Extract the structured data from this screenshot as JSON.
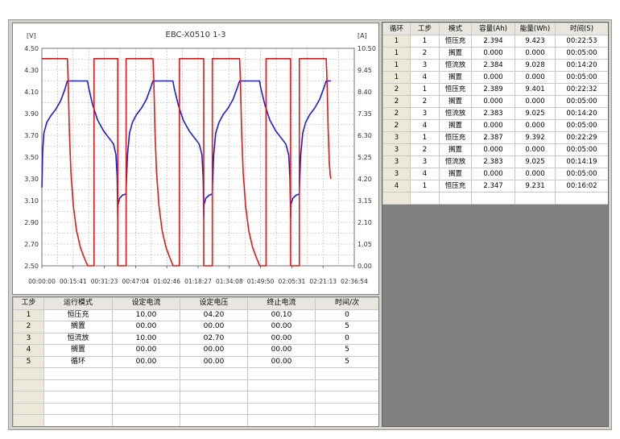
{
  "chart": {
    "title": "EBC-X0510 1-3",
    "left_unit": "[V]",
    "right_unit": "[A]",
    "left_ticks": [
      "4.50",
      "4.30",
      "4.10",
      "3.90",
      "3.70",
      "3.50",
      "3.30",
      "3.10",
      "2.90",
      "2.70",
      "2.50"
    ],
    "right_ticks": [
      "10.50",
      "9.45",
      "8.40",
      "7.35",
      "6.30",
      "5.25",
      "4.20",
      "3.15",
      "2.10",
      "1.05",
      "0.00"
    ],
    "x_ticks": [
      "00:00:00",
      "00:15:41",
      "00:31:23",
      "00:47:04",
      "01:02:46",
      "01:18:27",
      "01:34:08",
      "01:49:50",
      "02:05:31",
      "02:21:13",
      "02:36:54"
    ]
  },
  "chart_data": {
    "type": "line",
    "title": "EBC-X0510 1-3",
    "xlabel": "",
    "ylabel": "[V]",
    "y2label": "[A]",
    "x_unit": "minutes",
    "xlim": [
      0,
      156.9
    ],
    "ylim": [
      2.5,
      4.5
    ],
    "y2lim": [
      0,
      10.5
    ],
    "grid": true,
    "series": [
      {
        "name": "",
        "axis": "left",
        "color": "#1c1cd8",
        "points": [
          [
            0,
            3.22
          ],
          [
            0.4,
            3.55
          ],
          [
            1,
            3.72
          ],
          [
            2.5,
            3.82
          ],
          [
            4.5,
            3.88
          ],
          [
            7,
            3.94
          ],
          [
            9.5,
            4.02
          ],
          [
            11.5,
            4.12
          ],
          [
            12.8,
            4.2
          ],
          [
            22.9,
            4.2
          ],
          [
            23.6,
            4.13
          ],
          [
            25.5,
            3.98
          ],
          [
            28,
            3.84
          ],
          [
            31,
            3.74
          ],
          [
            33.5,
            3.68
          ],
          [
            36,
            3.62
          ],
          [
            37.2,
            3.52
          ],
          [
            37.8,
            3.32
          ],
          [
            38.1,
            2.95
          ],
          [
            38.2,
            3.06
          ],
          [
            39,
            3.12
          ],
          [
            40.5,
            3.15
          ],
          [
            42.3,
            3.16
          ],
          [
            42.4,
            3.25
          ],
          [
            43,
            3.52
          ],
          [
            44,
            3.72
          ],
          [
            45.5,
            3.82
          ],
          [
            47.5,
            3.89
          ],
          [
            50,
            3.95
          ],
          [
            52.5,
            4.03
          ],
          [
            54.5,
            4.13
          ],
          [
            55.8,
            4.2
          ],
          [
            65.8,
            4.2
          ],
          [
            66.5,
            4.13
          ],
          [
            68.5,
            3.98
          ],
          [
            71,
            3.84
          ],
          [
            74,
            3.74
          ],
          [
            76.5,
            3.68
          ],
          [
            79,
            3.62
          ],
          [
            80.4,
            3.52
          ],
          [
            81,
            3.3
          ],
          [
            81.3,
            2.95
          ],
          [
            81.4,
            3.06
          ],
          [
            82.3,
            3.12
          ],
          [
            84,
            3.15
          ],
          [
            85.6,
            3.16
          ],
          [
            85.7,
            3.25
          ],
          [
            86.3,
            3.52
          ],
          [
            87.3,
            3.72
          ],
          [
            89,
            3.82
          ],
          [
            91,
            3.89
          ],
          [
            93.5,
            3.95
          ],
          [
            96,
            4.03
          ],
          [
            98,
            4.13
          ],
          [
            99.3,
            4.2
          ],
          [
            109.3,
            4.2
          ],
          [
            110,
            4.13
          ],
          [
            112,
            3.98
          ],
          [
            114.5,
            3.84
          ],
          [
            117.5,
            3.74
          ],
          [
            120,
            3.68
          ],
          [
            122.5,
            3.62
          ],
          [
            124,
            3.52
          ],
          [
            124.6,
            3.3
          ],
          [
            124.9,
            2.95
          ],
          [
            125,
            3.06
          ],
          [
            126,
            3.12
          ],
          [
            127.7,
            3.15
          ],
          [
            129.3,
            3.16
          ],
          [
            129.4,
            3.25
          ],
          [
            130,
            3.52
          ],
          [
            131,
            3.72
          ],
          [
            132.5,
            3.82
          ],
          [
            134.5,
            3.89
          ],
          [
            137,
            3.95
          ],
          [
            139.5,
            4.03
          ],
          [
            141.5,
            4.13
          ],
          [
            142.8,
            4.2
          ],
          [
            145.2,
            4.2
          ]
        ]
      },
      {
        "name": "",
        "axis": "right",
        "color": "#e01818",
        "points": [
          [
            0,
            10.0
          ],
          [
            12.8,
            10.0
          ],
          [
            13.2,
            9.0
          ],
          [
            13.8,
            6.5
          ],
          [
            14.6,
            4.5
          ],
          [
            15.8,
            2.9
          ],
          [
            17.4,
            1.7
          ],
          [
            19.3,
            0.9
          ],
          [
            21.2,
            0.4
          ],
          [
            22.8,
            0.05
          ],
          [
            22.9,
            0
          ],
          [
            26.2,
            0
          ],
          [
            26.2,
            10.0
          ],
          [
            38.1,
            10.0
          ],
          [
            38.1,
            0
          ],
          [
            42.3,
            0
          ],
          [
            42.3,
            10.0
          ],
          [
            55.8,
            10.0
          ],
          [
            56.2,
            9.0
          ],
          [
            56.8,
            6.5
          ],
          [
            57.6,
            4.5
          ],
          [
            58.8,
            2.9
          ],
          [
            60.4,
            1.7
          ],
          [
            62.3,
            0.9
          ],
          [
            64.2,
            0.4
          ],
          [
            65.7,
            0.05
          ],
          [
            65.8,
            0
          ],
          [
            69.1,
            0
          ],
          [
            69.1,
            10.0
          ],
          [
            81.3,
            10.0
          ],
          [
            81.3,
            0
          ],
          [
            85.6,
            0
          ],
          [
            85.6,
            10.0
          ],
          [
            99.3,
            10.0
          ],
          [
            99.7,
            9.0
          ],
          [
            100.3,
            6.5
          ],
          [
            101.1,
            4.5
          ],
          [
            102.3,
            2.9
          ],
          [
            103.9,
            1.7
          ],
          [
            105.8,
            0.9
          ],
          [
            107.7,
            0.4
          ],
          [
            109.2,
            0.05
          ],
          [
            109.3,
            0
          ],
          [
            112.6,
            0
          ],
          [
            112.6,
            10.0
          ],
          [
            124.9,
            10.0
          ],
          [
            124.9,
            0
          ],
          [
            129.3,
            0
          ],
          [
            129.3,
            10.0
          ],
          [
            142.8,
            10.0
          ],
          [
            143.2,
            9.0
          ],
          [
            143.8,
            6.5
          ],
          [
            144.4,
            4.9
          ],
          [
            144.9,
            4.3
          ],
          [
            145.2,
            4.2
          ]
        ]
      }
    ]
  },
  "steps_table": {
    "columns": [
      "工步",
      "运行模式",
      "设定电流",
      "设定电压",
      "终止电流",
      "时间/次"
    ],
    "rows": [
      [
        "1",
        "恒压充",
        "10.00",
        "04.20",
        "00.10",
        "0"
      ],
      [
        "2",
        "搁置",
        "00.00",
        "00.00",
        "00.00",
        "5"
      ],
      [
        "3",
        "恒流放",
        "10.00",
        "02.70",
        "00.00",
        "0"
      ],
      [
        "4",
        "搁置",
        "00.00",
        "00.00",
        "00.00",
        "5"
      ],
      [
        "5",
        "循环",
        "00.00",
        "00.00",
        "00.00",
        "5"
      ]
    ],
    "empty_rows": 6
  },
  "results_table": {
    "columns": [
      "循环",
      "工步",
      "模式",
      "容量(Ah)",
      "能量(Wh)",
      "时间(S)"
    ],
    "rows": [
      [
        "1",
        "1",
        "恒压充",
        "2.394",
        "9.423",
        "00:22:53"
      ],
      [
        "1",
        "2",
        "搁置",
        "0.000",
        "0.000",
        "00:05:00"
      ],
      [
        "1",
        "3",
        "恒流放",
        "2.384",
        "9.028",
        "00:14:20"
      ],
      [
        "1",
        "4",
        "搁置",
        "0.000",
        "0.000",
        "00:05:00"
      ],
      [
        "2",
        "1",
        "恒压充",
        "2.389",
        "9.401",
        "00:22:32"
      ],
      [
        "2",
        "2",
        "搁置",
        "0.000",
        "0.000",
        "00:05:00"
      ],
      [
        "2",
        "3",
        "恒流放",
        "2.383",
        "9.025",
        "00:14:20"
      ],
      [
        "2",
        "4",
        "搁置",
        "0.000",
        "0.000",
        "00:05:00"
      ],
      [
        "3",
        "1",
        "恒压充",
        "2.387",
        "9.392",
        "00:22:29"
      ],
      [
        "3",
        "2",
        "搁置",
        "0.000",
        "0.000",
        "00:05:00"
      ],
      [
        "3",
        "3",
        "恒流放",
        "2.383",
        "9.025",
        "00:14:19"
      ],
      [
        "3",
        "4",
        "搁置",
        "0.000",
        "0.000",
        "00:05:00"
      ],
      [
        "4",
        "1",
        "恒压充",
        "2.347",
        "9.231",
        "00:16:02"
      ]
    ],
    "empty_rows": 1
  }
}
